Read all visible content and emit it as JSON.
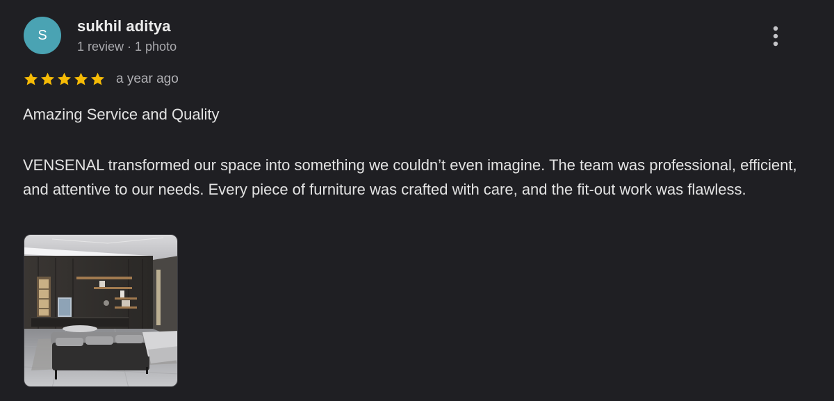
{
  "review": {
    "author": {
      "initial": "S",
      "name": "sukhil aditya",
      "meta": "1 review · 1 photo",
      "avatar_color": "#4aa3b3"
    },
    "rating": {
      "stars": 5,
      "max_stars": 5,
      "star_color": "#f6bb06",
      "date": "a year ago"
    },
    "title": "Amazing Service and Quality",
    "body": "VENSENAL transformed our space into something we couldn’t even imagine. The team was professional, efficient, and attentive to our needs. Every piece of furniture was crafted with care, and the fit-out work was flawless.",
    "photos": [
      {
        "alt": "living room with wall shelving unit and grey sofa"
      }
    ],
    "actions": {
      "more_icon": "more-vertical-icon"
    }
  }
}
